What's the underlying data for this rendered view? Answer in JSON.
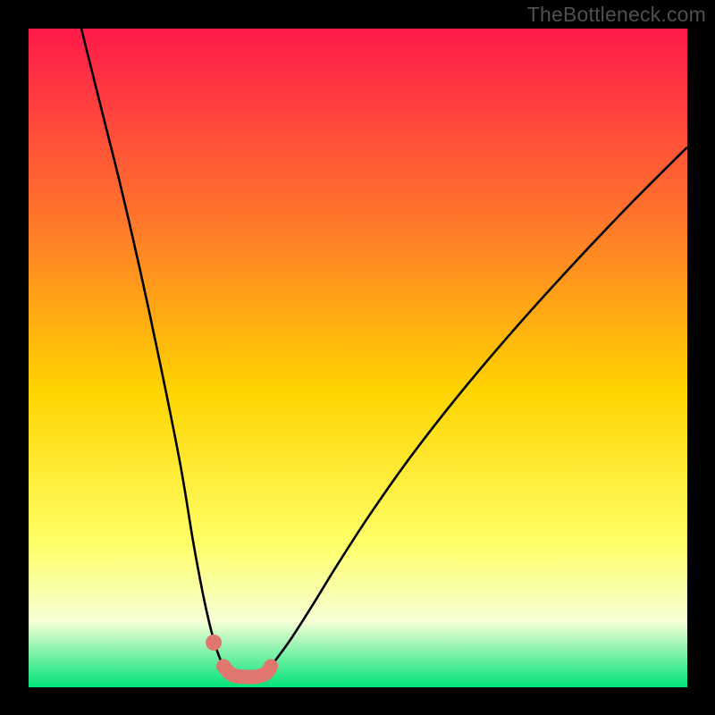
{
  "watermark": "TheBottleneck.com",
  "colors": {
    "background": "#000000",
    "gradient_top": "#ff1a4b",
    "gradient_mid_upper": "#ff7a2a",
    "gradient_mid": "#ffd400",
    "gradient_mid_lower": "#ffff66",
    "gradient_pale": "#f6ffd6",
    "gradient_bottom": "#00e37a",
    "curve": "#000000",
    "marker": "#e0776e"
  },
  "chart_data": {
    "type": "line",
    "title": "",
    "xlabel": "",
    "ylabel": "",
    "xlim": [
      0,
      100
    ],
    "ylim": [
      0,
      100
    ],
    "annotations": [],
    "series": [
      {
        "name": "left-arm",
        "x": [
          8,
          11,
          14,
          17,
          20,
          23,
          25,
          26.5,
          27.5,
          28.3,
          29,
          29.6
        ],
        "y": [
          100,
          88,
          76,
          63,
          49,
          34,
          22,
          14,
          9.5,
          6.5,
          4.5,
          3.2
        ]
      },
      {
        "name": "right-arm",
        "x": [
          36.8,
          38,
          40,
          43,
          47,
          52,
          58,
          65,
          73,
          82,
          91,
          100
        ],
        "y": [
          3.2,
          4.8,
          7.6,
          12.3,
          18.8,
          26.5,
          35,
          44,
          53.5,
          63.5,
          73,
          82
        ]
      },
      {
        "name": "valley-floor-marker",
        "x": [
          29.6,
          30.5,
          31.5,
          33,
          34.5,
          36,
          36.8
        ],
        "y": [
          3.2,
          2.2,
          1.7,
          1.6,
          1.6,
          2.1,
          3.2
        ]
      }
    ],
    "points": [
      {
        "name": "left-dot",
        "x": 28.1,
        "y": 6.8
      }
    ]
  }
}
